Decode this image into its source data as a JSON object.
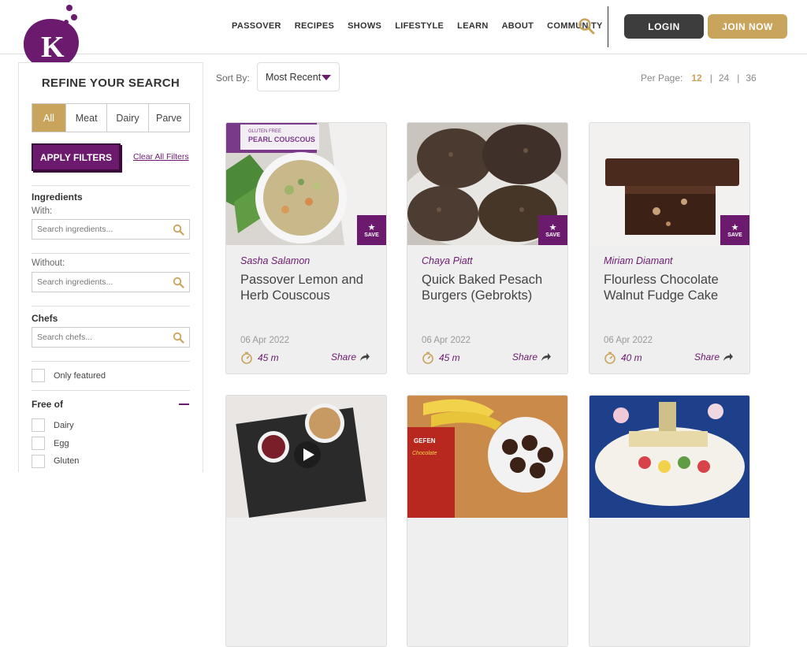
{
  "brand": {
    "logo_letter": "K",
    "accent": "#6b1a6e",
    "gold": "#c9a45c"
  },
  "nav": {
    "items": [
      "PASSOVER",
      "RECIPES",
      "SHOWS",
      "LIFESTYLE",
      "LEARN",
      "ABOUT",
      "COMMUNITY"
    ]
  },
  "header": {
    "login_label": "LOGIN",
    "join_label": "JOIN NOW"
  },
  "sidebar": {
    "title": "REFINE YOUR SEARCH",
    "segments": [
      "All",
      "Meat",
      "Dairy",
      "Parve"
    ],
    "apply_label": "APPLY FILTERS",
    "clear_label": "Clear All Filters",
    "ingredients_label": "Ingredients",
    "with_label": "With:",
    "with_placeholder": "Search ingredients...",
    "without_label": "Without:",
    "without_placeholder": "Search ingredients...",
    "chefs_label": "Chefs",
    "chefs_placeholder": "Search chefs...",
    "featured_label": "Only featured",
    "free_of_label": "Free of",
    "free_of_items": [
      "Dairy",
      "Egg",
      "Gluten"
    ]
  },
  "sort": {
    "label": "Sort By:",
    "value": "Most Recent"
  },
  "per_page": {
    "label": "Per Page:",
    "options": [
      "12",
      "24",
      "36"
    ],
    "selected": "12"
  },
  "cards": [
    {
      "chef": "Sasha Salamon",
      "title": "Passover Lemon and Herb Couscous",
      "date": "06 Apr 2022",
      "time": "45 m",
      "share": "Share",
      "save": "SAVE",
      "image": "couscous-bowl"
    },
    {
      "chef": "Chaya Piatt",
      "title": "Quick Baked Pesach Burgers (Gebrokts)",
      "date": "06 Apr 2022",
      "time": "45 m",
      "share": "Share",
      "save": "SAVE",
      "image": "burgers"
    },
    {
      "chef": "Miriam Diamant",
      "title": "Flourless Chocolate Walnut Fudge Cake",
      "date": "06 Apr 2022",
      "time": "40 m",
      "share": "Share",
      "save": "SAVE",
      "image": "fudge-cake"
    }
  ],
  "image_labels": {
    "couscous_pkg_small": "GLUTEN FREE",
    "couscous_pkg": "PEARL COUSCOUS",
    "gefen_brand": "GEFEN",
    "gefen_product": "Chocolate"
  }
}
